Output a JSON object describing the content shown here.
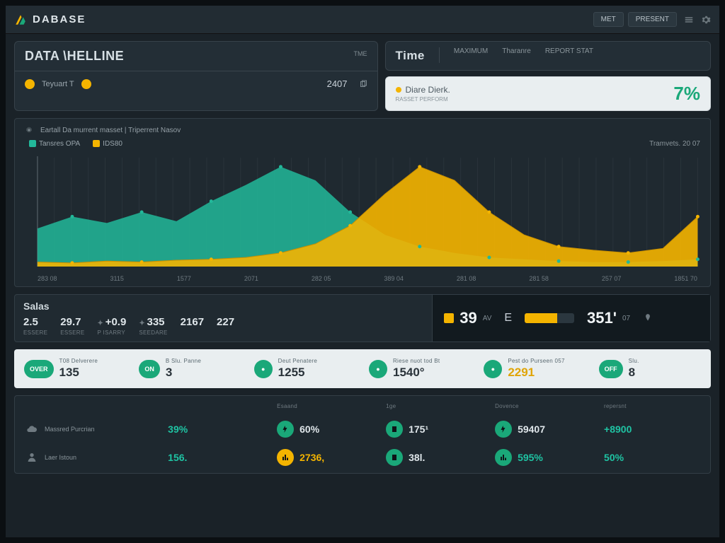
{
  "colors": {
    "teal": "#1aa879",
    "amber": "#f4b400",
    "bg": "#1a2228"
  },
  "topbar": {
    "brand": "DABASE",
    "buttons": [
      "MET",
      "PRESENT"
    ],
    "icons": [
      "menu-icon",
      "settings-icon"
    ]
  },
  "card_data": {
    "title": "DATA \\HELLINE",
    "tag_right": "TME",
    "pill_label": "Teyuart T",
    "value": "2407"
  },
  "card_time": {
    "title": "Time",
    "tabs": [
      "MAXIMUM",
      "Tharanre",
      "REPORT STAT"
    ]
  },
  "card_light": {
    "label": "Diare Dierk.",
    "sub": "RASSET PERFORM",
    "pct": "7%"
  },
  "chart": {
    "header": "Eartall Da murrent masset | Triperrent Nasov",
    "legend_a": "Tansres OPA",
    "legend_b": "IDS80",
    "right_label": "Tramvets. 20 07"
  },
  "chart_data": {
    "type": "area",
    "x_ticks": [
      "283 08",
      "3115",
      "1577",
      "2071",
      "282 05",
      "389 04",
      "281 08",
      "281 58",
      "257 07",
      "1851 70"
    ],
    "series": [
      {
        "name": "Tansres OPA",
        "color": "#22b89a",
        "values": [
          42,
          55,
          48,
          60,
          50,
          72,
          90,
          110,
          95,
          60,
          35,
          22,
          15,
          10,
          8,
          6,
          5,
          5,
          6,
          8
        ]
      },
      {
        "name": "IDS80",
        "color": "#f4b400",
        "values": [
          5,
          4,
          6,
          5,
          7,
          8,
          10,
          15,
          25,
          45,
          80,
          110,
          95,
          60,
          35,
          22,
          18,
          15,
          20,
          55
        ]
      }
    ],
    "ylim": [
      0,
      120
    ]
  },
  "sales": {
    "title": "Salas",
    "cells": [
      {
        "v": "2.5",
        "l": "ESSERE"
      },
      {
        "v": "29.7",
        "l": "ESSERE"
      },
      {
        "v": "+0.9",
        "l": "P ISARRY",
        "star": true
      },
      {
        "v": "335",
        "l": "SEEDARE",
        "star": true
      },
      {
        "v": "2167",
        "l": ""
      },
      {
        "v": "227",
        "l": ""
      }
    ],
    "right": {
      "big": "39",
      "unit": "AV",
      "mid": "E",
      "bar_pct": 65,
      "big2": "351'",
      "unit2": "07"
    }
  },
  "light_row": [
    {
      "lbl": "T08 Delverere",
      "badge": "OVER",
      "val": "135"
    },
    {
      "lbl": "",
      "badge": "ON",
      "val": "3",
      "sub": "B Slu. Panne"
    },
    {
      "lbl": "Deut Penatere",
      "badge": "",
      "val": "1255"
    },
    {
      "lbl": "Riese nuot tod Bt",
      "badge": "",
      "val": "1540°"
    },
    {
      "lbl": "Pest do Purseen 057",
      "badge": "",
      "val": "2291",
      "amber": true
    },
    {
      "lbl": "",
      "badge": "OFF",
      "val": "8",
      "sub": "Slu."
    }
  ],
  "dark_grid": {
    "row1_lead": "Massred Purcrian",
    "row2_lead": "Laer Istoun",
    "cols": [
      {
        "h": "",
        "r1": "39%",
        "r2": "156.",
        "r1c": "teal",
        "r2c": "teal"
      },
      {
        "h": "Esaand",
        "r1": "60%",
        "r2": "2736,",
        "r1c": "",
        "r2c": "amber",
        "ic1": "teal",
        "ic2": "amber"
      },
      {
        "h": "1ge",
        "r1": "175¹",
        "r2": "38l.",
        "ic1": "teal",
        "ic2": "teal"
      },
      {
        "h": "Dovence",
        "r1": "59407",
        "r2": "595%",
        "ic1": "teal",
        "ic2": "teal",
        "r2c": "teal"
      },
      {
        "h": "repersnt",
        "r1": "+8900",
        "r2": "50%",
        "r1c": "teal",
        "r2c": "teal"
      }
    ]
  }
}
